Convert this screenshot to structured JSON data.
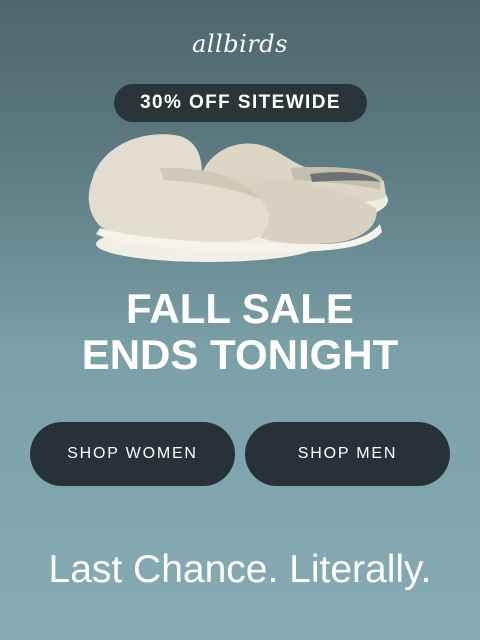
{
  "brand": {
    "logo_text": "allbirds"
  },
  "promo": {
    "badge": "30% OFF SITEWIDE"
  },
  "product": {
    "image_icon": "slipper-clogs-image"
  },
  "headline": {
    "line1": "FALL SALE",
    "line2": "ENDS TONIGHT"
  },
  "buttons": {
    "women_label": "SHOP WOMEN",
    "men_label": "SHOP MEN"
  },
  "tagline": {
    "text": "Last Chance. Literally."
  },
  "colors": {
    "button_bg": "#263237",
    "pill_bg": "#2a3539",
    "text": "#ffffff"
  }
}
